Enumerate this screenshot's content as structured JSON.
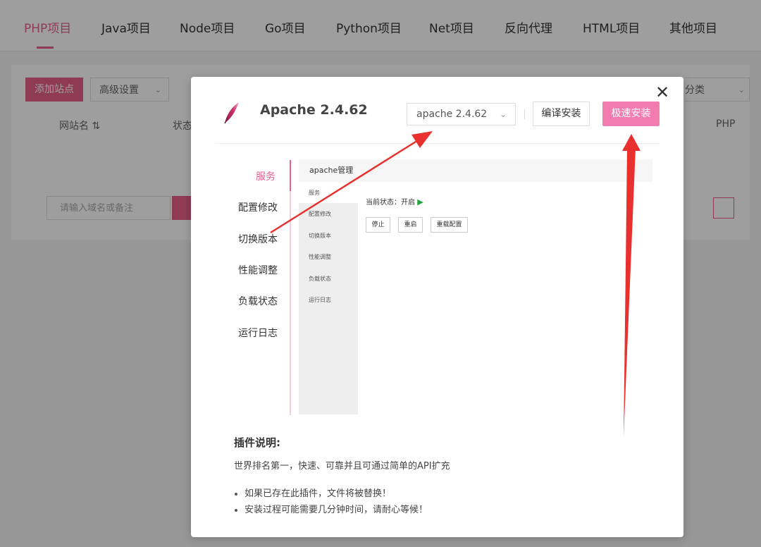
{
  "tabs": [
    {
      "label": "PHP项目",
      "active": true
    },
    {
      "label": "Java项目",
      "active": false
    },
    {
      "label": "Node项目",
      "active": false
    },
    {
      "label": "Go项目",
      "active": false
    },
    {
      "label": "Python项目",
      "active": false
    },
    {
      "label": "Net项目",
      "active": false
    },
    {
      "label": "反向代理",
      "active": false
    },
    {
      "label": "HTML项目",
      "active": false
    },
    {
      "label": "其他项目",
      "active": false
    }
  ],
  "background": {
    "add_site_label": "添加站点",
    "advanced_label": "高级设置",
    "col_site_name": "网站名 ⇅",
    "col_status": "状态",
    "col_php": "PHP",
    "search_placeholder": "请输入域名或备注",
    "category_label": "分类"
  },
  "modal": {
    "title": "Apache 2.4.62",
    "version_selected": "apache 2.4.62",
    "compile_install_label": "编译安装",
    "fast_install_label": "极速安装",
    "close_symbol": "✕",
    "side_nav": [
      "服务",
      "配置修改",
      "切换版本",
      "性能调整",
      "负载状态",
      "运行日志"
    ],
    "preview": {
      "header": "apache管理",
      "side": [
        "服务",
        "配置修改",
        "切换版本",
        "性能调整",
        "负载状态",
        "运行日志"
      ],
      "status_label": "当前状态：开启",
      "status_icon": "play-icon",
      "buttons": [
        "停止",
        "重启",
        "重载配置"
      ]
    },
    "description_title": "插件说明:",
    "description": "世界排名第一，快速、可靠并且可通过简单的API扩充",
    "notes": [
      "如果已存在此插件，文件将被替换！",
      "安装过程可能需要几分钟时间，请耐心等候！"
    ]
  },
  "colors": {
    "accent": "#e8608c",
    "fast_install_bg": "#f27bb0",
    "arrow": "#e8312f",
    "running_green": "#20a53a"
  }
}
